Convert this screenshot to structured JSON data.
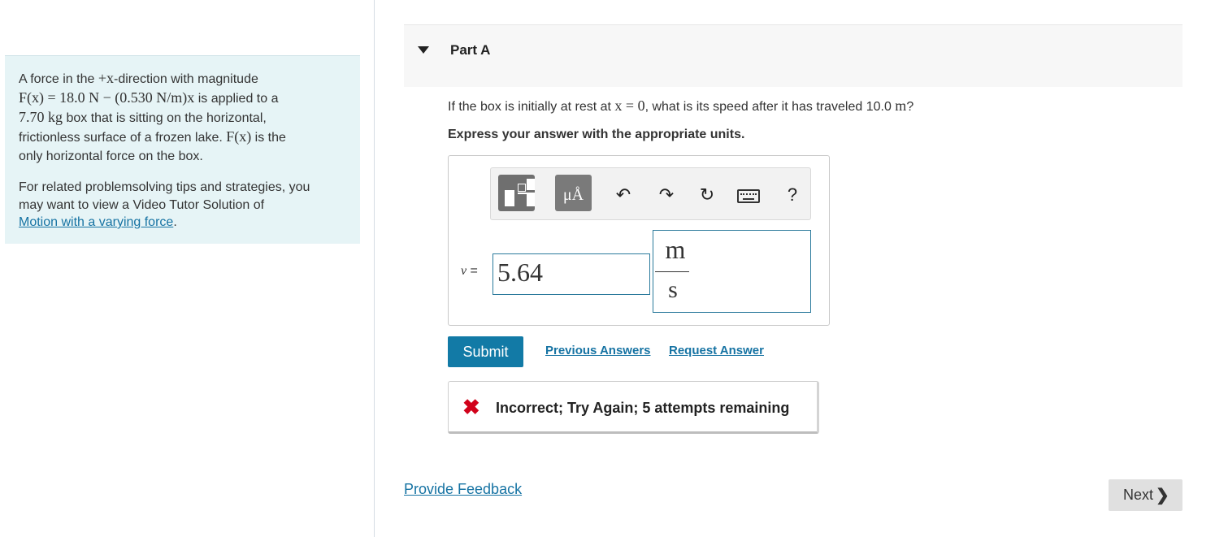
{
  "problem": {
    "p1_a": "A force in the ",
    "p1_b": "+x",
    "p1_c": "-direction with magnitude",
    "p1_d": "F(x) = 18.0 N − (0.530 N/m)x",
    "p1_e": " is applied to a",
    "p1_f": "7.70 kg",
    "p1_g": " box that is sitting on the horizontal,",
    "p1_h": "frictionless surface of a frozen lake. ",
    "p1_i": "F(x)",
    "p1_j": " is the",
    "p1_k": "only horizontal force on the box.",
    "p2_a": "For related problemsolving tips and strategies, you",
    "p2_b": "may want to view a Video Tutor Solution of",
    "p2_link": "Motion with a varying force",
    "p2_end": "."
  },
  "part": {
    "title": "Part A"
  },
  "question": {
    "a": "If the box is initially at rest at ",
    "b": "x = 0",
    "c": ", what is its speed after it has traveled 10.0 ",
    "d": "m",
    "e": "?"
  },
  "instruction": "Express your answer with the appropriate units.",
  "toolbar": {
    "units_glyph": "μÅ",
    "undo": "↶",
    "redo": "↷",
    "reset": "↻",
    "help": "?",
    "icons": [
      "templates-icon",
      "units-icon",
      "undo-icon",
      "redo-icon",
      "reset-icon",
      "keyboard-icon",
      "help-icon"
    ]
  },
  "answer": {
    "var": "v",
    "eq": " =",
    "value": "5.64",
    "unit_numerator": "m",
    "unit_denominator": "s"
  },
  "actions": {
    "submit": "Submit",
    "previous_answers": "Previous Answers",
    "request_answer": "Request Answer"
  },
  "feedback": {
    "icon": "✖",
    "text": "Incorrect; Try Again; 5 attempts remaining"
  },
  "footer": {
    "provide_feedback": "Provide Feedback",
    "next": "Next",
    "next_chevron": "❯"
  },
  "colors": {
    "accent": "#127aa6",
    "link": "#1673a3",
    "error": "#d1021b",
    "problem_bg": "#e6f4f6"
  }
}
